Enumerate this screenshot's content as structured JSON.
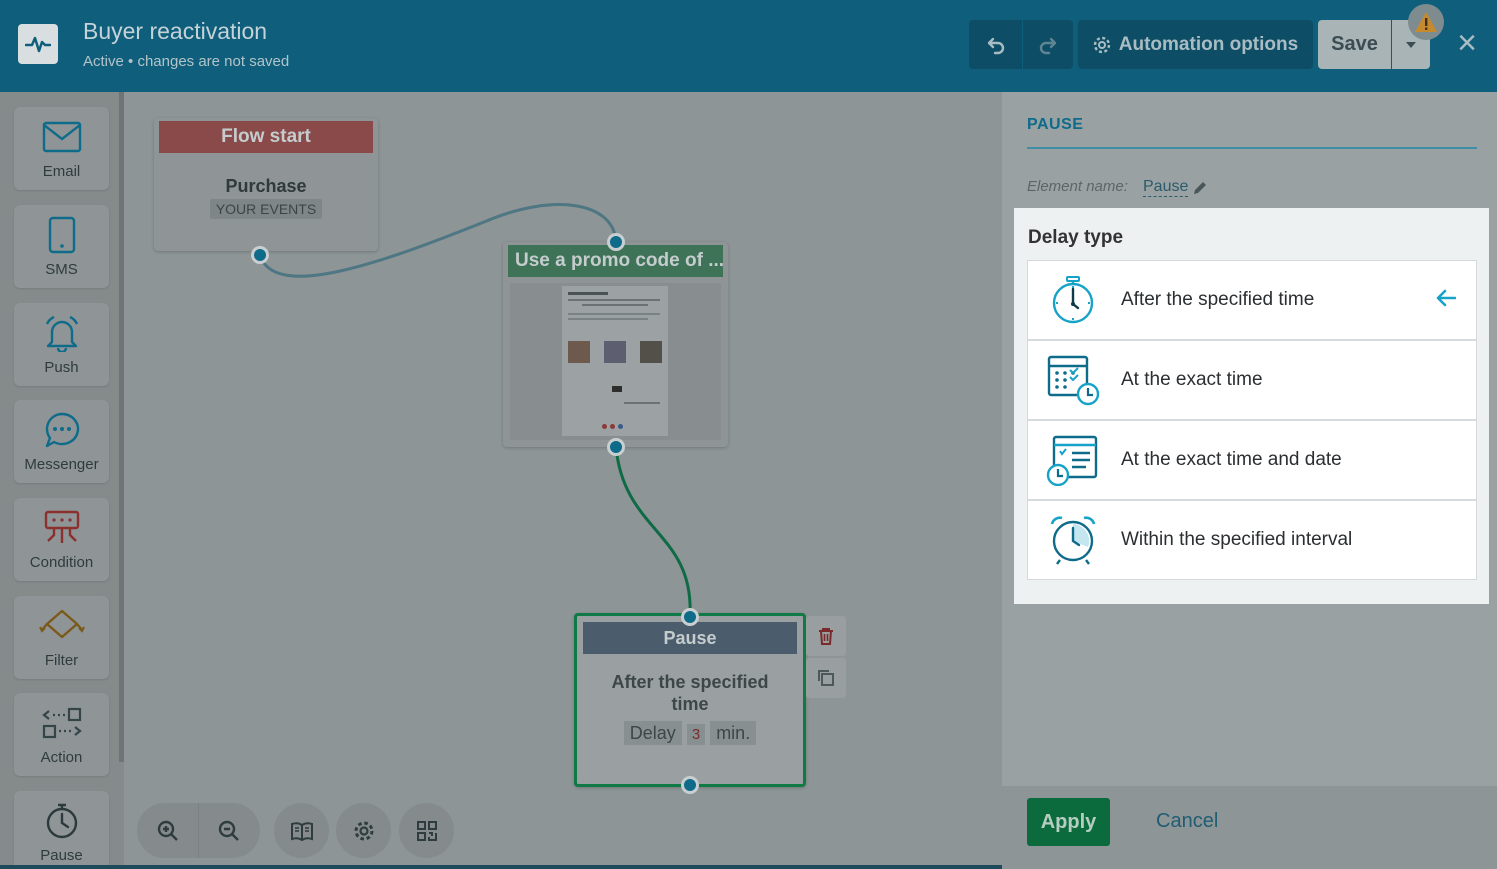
{
  "header": {
    "title": "Buyer reactivation",
    "status": "Active",
    "subtitle_sep": " • ",
    "subtitle_note": "changes are not saved",
    "options_label": "Automation options",
    "save_label": "Save",
    "close_icon": "×"
  },
  "sidebar": {
    "items": [
      {
        "label": "Email",
        "icon": "envelope-icon"
      },
      {
        "label": "SMS",
        "icon": "phone-icon"
      },
      {
        "label": "Push",
        "icon": "bell-icon"
      },
      {
        "label": "Messenger",
        "icon": "chat-icon"
      },
      {
        "label": "Condition",
        "icon": "condition-icon"
      },
      {
        "label": "Filter",
        "icon": "filter-icon"
      },
      {
        "label": "Action",
        "icon": "action-icon"
      },
      {
        "label": "Pause",
        "icon": "stopwatch-icon"
      }
    ]
  },
  "canvas": {
    "flow_start": {
      "header": "Flow start",
      "event": "Purchase",
      "tag": "YOUR EVENTS"
    },
    "email_node": {
      "header": "Use a promo code of ..."
    },
    "pause_node": {
      "header": "Pause",
      "text": "After the specified time",
      "delay_label": "Delay",
      "delay_value": "3",
      "delay_unit": "min."
    }
  },
  "panel": {
    "title": "PAUSE",
    "element_name_label": "Element name:",
    "element_name_value": "Pause",
    "delay_type_title": "Delay type",
    "options": [
      {
        "label": "After the specified time",
        "icon": "stopwatch-icon",
        "selected": true
      },
      {
        "label": "At the exact time",
        "icon": "calendar-clock-icon",
        "selected": false
      },
      {
        "label": "At the exact time and date",
        "icon": "list-clock-icon",
        "selected": false
      },
      {
        "label": "Within the specified interval",
        "icon": "alarm-clock-icon",
        "selected": false
      }
    ],
    "apply_label": "Apply",
    "cancel_label": "Cancel"
  },
  "colors": {
    "header": "#0f5f7c",
    "accent": "#17a2c7",
    "apply": "#0b6b3d",
    "flow_start_header": "#b73a3a",
    "email_header": "#0f8a4a",
    "pause_header": "#4f6d88"
  }
}
